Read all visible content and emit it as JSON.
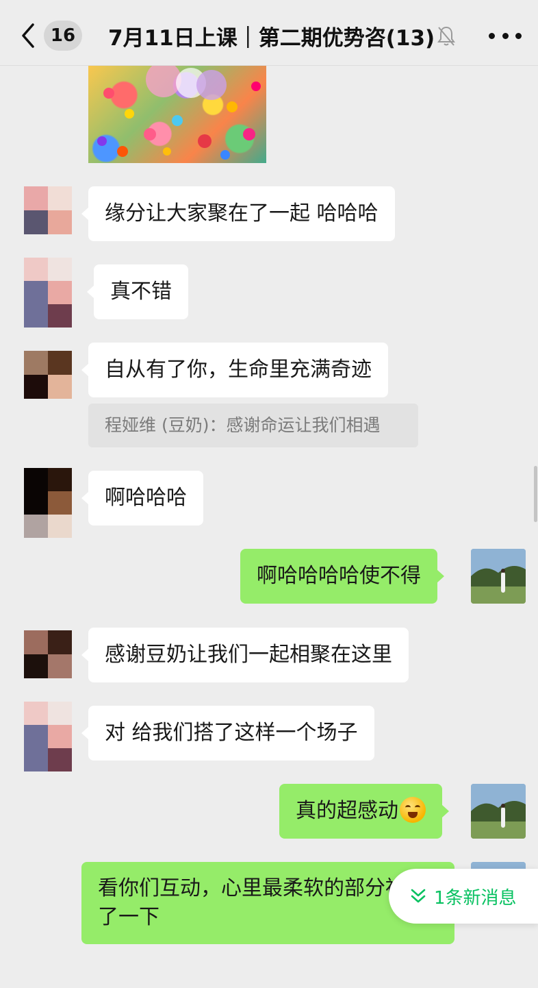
{
  "header": {
    "unread_count": "16",
    "title": "7月11日上课｜第二期优势咨(13)",
    "icons": [
      "back-chevron-icon",
      "bell-muted-icon",
      "more-dots-icon"
    ]
  },
  "messages": [
    {
      "side": "left",
      "text": "缘分让大家聚在了一起 哈哈哈"
    },
    {
      "side": "left",
      "text": "真不错"
    },
    {
      "side": "left",
      "text": "自从有了你，生命里充满奇迹",
      "quote": "程娅维 (豆奶)：感谢命运让我们相遇"
    },
    {
      "side": "left",
      "text": "啊哈哈哈"
    },
    {
      "side": "right",
      "text": "啊哈哈哈哈使不得"
    },
    {
      "side": "left",
      "text": "感谢豆奶让我们一起相聚在这里"
    },
    {
      "side": "left",
      "text": "对 给我们搭了这样一个场子"
    },
    {
      "side": "right",
      "text": "真的超感动",
      "emoji": "crying-face-icon"
    },
    {
      "side": "right",
      "text": "看你们互动，心里最柔软的部分被戳了一下"
    }
  ],
  "new_message_pill": {
    "label": "1条新消息"
  },
  "colors": {
    "background": "#ededed",
    "self_bubble": "#95ec69",
    "other_bubble": "#ffffff",
    "accent": "#07c160"
  }
}
